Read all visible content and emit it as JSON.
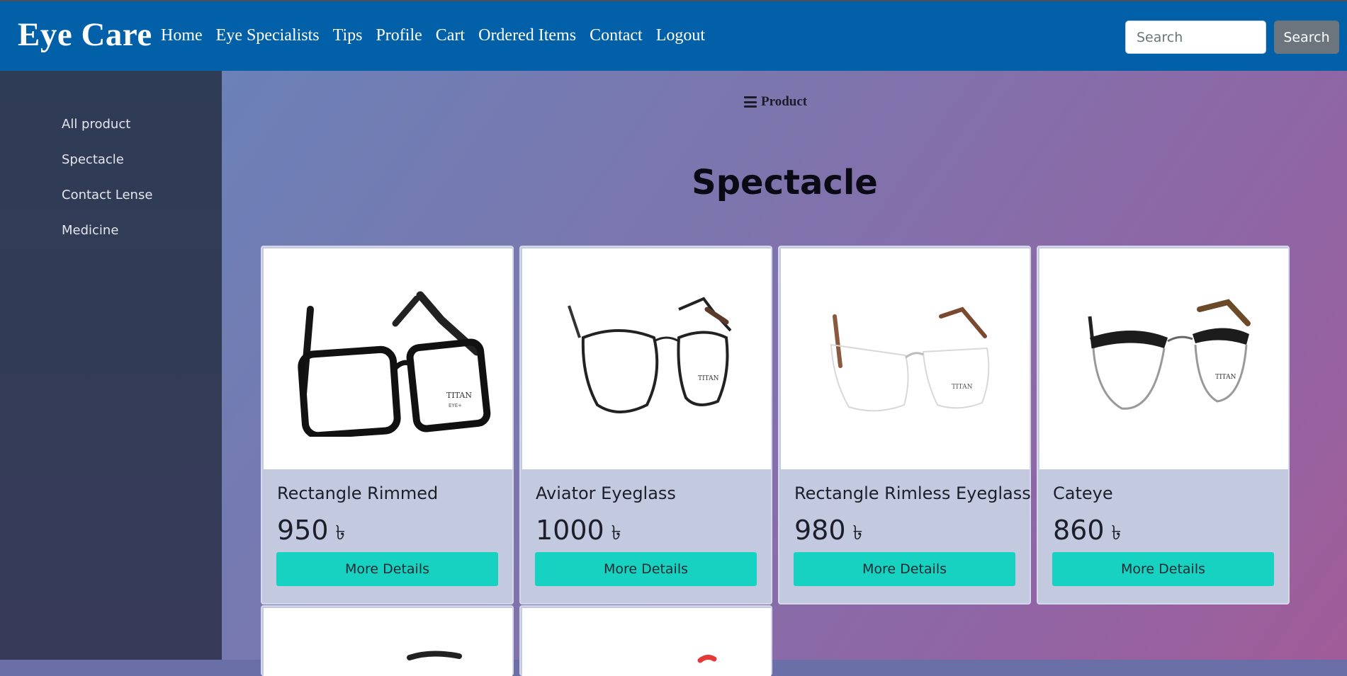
{
  "navbar": {
    "brand": "Eye Care",
    "links": [
      "Home",
      "Eye Specialists",
      "Tips",
      "Profile",
      "Cart",
      "Ordered Items",
      "Contact",
      "Logout"
    ],
    "search_placeholder": "Search",
    "search_button": "Search"
  },
  "sidebar": {
    "items": [
      "All product",
      "Spectacle",
      "Contact Lense",
      "Medicine"
    ]
  },
  "main": {
    "toggle_label": "Product",
    "section_title": "Spectacle",
    "products": [
      {
        "name": "Rectangle Rimmed",
        "price": "950",
        "currency": "৳",
        "button": "More Details",
        "image": "black-rectangle-glasses"
      },
      {
        "name": "Aviator Eyeglass",
        "price": "1000",
        "currency": "৳",
        "button": "More Details",
        "image": "round-metal-glasses"
      },
      {
        "name": "Rectangle Rimless Eyeglass",
        "price": "980",
        "currency": "৳",
        "button": "More Details",
        "image": "rimless-glasses"
      },
      {
        "name": "Cateye",
        "price": "860",
        "currency": "৳",
        "button": "More Details",
        "image": "browline-glasses"
      }
    ]
  },
  "colors": {
    "navbar": "#0160a8",
    "accent_button": "#17d1c1",
    "search_button": "#6c757d",
    "sidebar": "#2f3c55"
  }
}
